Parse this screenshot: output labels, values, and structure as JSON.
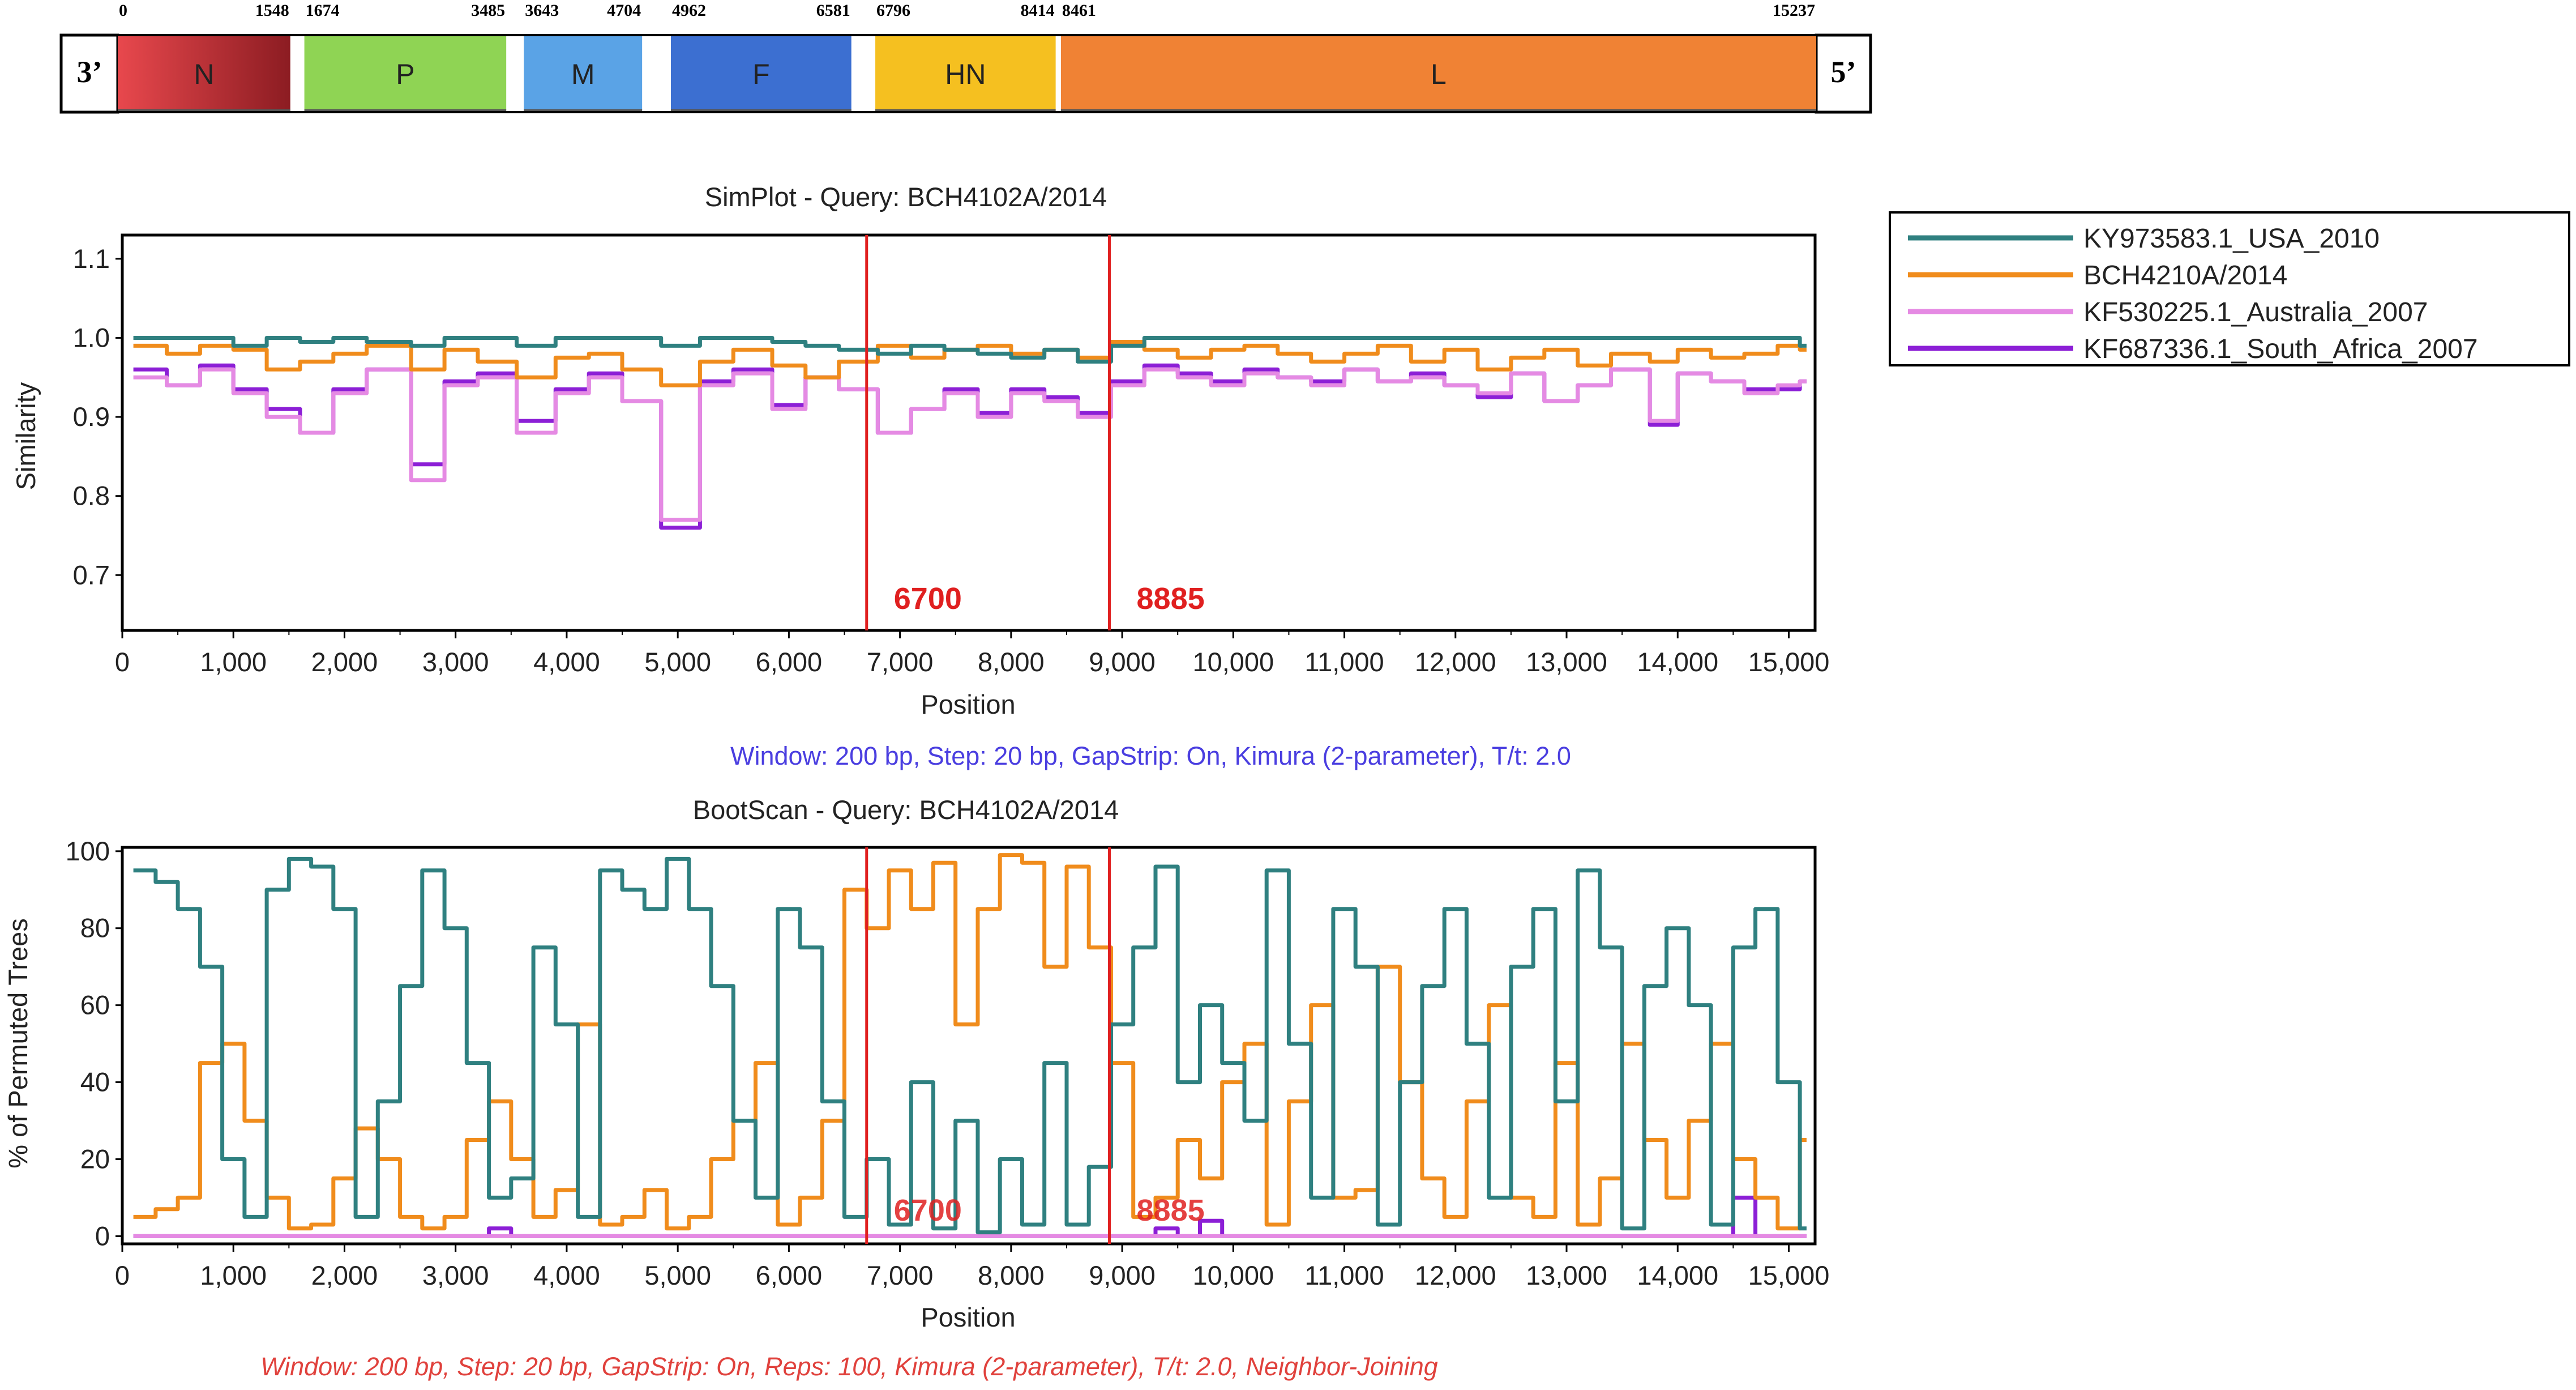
{
  "genome_map": {
    "left_end": "3’",
    "right_end": "5’",
    "genes": [
      {
        "name": "N",
        "start": "0",
        "end": "1548",
        "color": "#e8484d",
        "color2": "#8c1c22"
      },
      {
        "name": "P",
        "start": "1674",
        "end": "3485",
        "color": "#8fd454"
      },
      {
        "name": "M",
        "start": "3643",
        "end": "4704",
        "color": "#5aa3e6"
      },
      {
        "name": "F",
        "start": "4962",
        "end": "6581",
        "color": "#3c6fd1"
      },
      {
        "name": "HN",
        "start": "6796",
        "end": "8414",
        "color": "#f5c020"
      },
      {
        "name": "L",
        "start": "8461",
        "end": "15237",
        "color": "#f08234"
      }
    ]
  },
  "legend": [
    {
      "name": "KY973583.1_USA_2010",
      "color": "#2f8080"
    },
    {
      "name": "BCH4210A/2014",
      "color": "#f08c1c"
    },
    {
      "name": "KF530225.1_Australia_2007",
      "color": "#e58ae3"
    },
    {
      "name": "KF687336.1_South_Africa_2007",
      "color": "#8c1fd6"
    }
  ],
  "simplot": {
    "title": "SimPlot - Query: BCH4102A/2014",
    "ylabel": "Similarity",
    "xlabel": "Position",
    "footer": "Window: 200 bp, Step: 20 bp, GapStrip: On, Kimura (2-parameter), T/t: 2.0",
    "footer_color": "#4a3ee0",
    "breakpoints": [
      "6700",
      "8885"
    ]
  },
  "bootscan": {
    "title": "BootScan - Query: BCH4102A/2014",
    "ylabel": "% of Permuted Trees",
    "xlabel": "Position",
    "footer": "Window: 200 bp, Step: 20 bp, GapStrip: On, Reps: 100, Kimura (2-parameter), T/t: 2.0, Neighbor-Joining",
    "footer_color": "#e0413c",
    "breakpoints": [
      "6700",
      "8885"
    ]
  },
  "chart_data": [
    {
      "type": "line",
      "title": "SimPlot - Query: BCH4102A/2014",
      "xlabel": "Position",
      "ylabel": "Similarity",
      "xlim": [
        0,
        15237
      ],
      "ylim": [
        0.63,
        1.13
      ],
      "xticks": [
        "0",
        "1,000",
        "2,000",
        "3,000",
        "4,000",
        "5,000",
        "6,000",
        "7,000",
        "8,000",
        "9,000",
        "10,000",
        "11,000",
        "12,000",
        "13,000",
        "14,000",
        "15,000"
      ],
      "yticks": [
        "0.7",
        "0.8",
        "0.9",
        "1.0",
        "1.1"
      ],
      "breakpoints": [
        6700,
        8885
      ],
      "x": [
        100,
        400,
        700,
        1000,
        1300,
        1600,
        1900,
        2200,
        2600,
        2900,
        3200,
        3550,
        3900,
        4200,
        4500,
        4850,
        5200,
        5500,
        5850,
        6150,
        6450,
        6800,
        7100,
        7400,
        7700,
        8000,
        8300,
        8600,
        8900,
        9200,
        9500,
        9800,
        10100,
        10400,
        10700,
        11000,
        11300,
        11600,
        11900,
        12200,
        12500,
        12800,
        13100,
        13400,
        13750,
        14000,
        14300,
        14600,
        14900,
        15100
      ],
      "series": [
        {
          "name": "KY973583.1_USA_2010",
          "values": [
            1.0,
            1.0,
            1.0,
            0.99,
            1.0,
            0.995,
            1.0,
            0.995,
            0.99,
            1.0,
            1.0,
            0.99,
            1.0,
            1.0,
            1.0,
            0.99,
            1.0,
            1.0,
            0.995,
            0.99,
            0.985,
            0.98,
            0.99,
            0.985,
            0.98,
            0.975,
            0.985,
            0.97,
            0.99,
            1.0,
            1.0,
            1.0,
            1.0,
            1.0,
            1.0,
            1.0,
            1.0,
            1.0,
            1.0,
            1.0,
            1.0,
            1.0,
            1.0,
            1.0,
            1.0,
            1.0,
            1.0,
            1.0,
            1.0,
            0.99
          ]
        },
        {
          "name": "BCH4210A/2014",
          "values": [
            0.99,
            0.98,
            0.99,
            0.985,
            0.96,
            0.97,
            0.98,
            0.99,
            0.96,
            0.985,
            0.97,
            0.95,
            0.975,
            0.98,
            0.96,
            0.94,
            0.97,
            0.985,
            0.965,
            0.95,
            0.97,
            0.99,
            0.975,
            0.985,
            0.99,
            0.98,
            0.985,
            0.975,
            0.995,
            0.985,
            0.975,
            0.985,
            0.99,
            0.98,
            0.97,
            0.98,
            0.99,
            0.97,
            0.985,
            0.96,
            0.975,
            0.985,
            0.965,
            0.98,
            0.97,
            0.985,
            0.975,
            0.98,
            0.99,
            0.985
          ]
        },
        {
          "name": "KF530225.1_Australia_2007",
          "values": [
            0.95,
            0.94,
            0.96,
            0.93,
            0.9,
            0.88,
            0.93,
            0.96,
            0.82,
            0.94,
            0.95,
            0.88,
            0.93,
            0.95,
            0.92,
            0.77,
            0.94,
            0.955,
            0.91,
            0.95,
            0.935,
            0.88,
            0.91,
            0.93,
            0.9,
            0.93,
            0.92,
            0.9,
            0.94,
            0.96,
            0.95,
            0.94,
            0.955,
            0.95,
            0.94,
            0.96,
            0.945,
            0.95,
            0.94,
            0.93,
            0.955,
            0.92,
            0.94,
            0.96,
            0.895,
            0.955,
            0.945,
            0.93,
            0.94,
            0.945
          ]
        },
        {
          "name": "KF687336.1_South_Africa_2007",
          "values": [
            0.96,
            0.94,
            0.965,
            0.935,
            0.91,
            0.88,
            0.935,
            0.96,
            0.84,
            0.945,
            0.955,
            0.895,
            0.935,
            0.955,
            0.92,
            0.76,
            0.945,
            0.96,
            0.915,
            0.95,
            0.935,
            0.88,
            0.91,
            0.935,
            0.905,
            0.935,
            0.925,
            0.905,
            0.945,
            0.965,
            0.955,
            0.945,
            0.96,
            0.95,
            0.945,
            0.96,
            0.945,
            0.955,
            0.94,
            0.925,
            0.955,
            0.92,
            0.94,
            0.96,
            0.89,
            0.955,
            0.945,
            0.935,
            0.935,
            0.945
          ]
        }
      ]
    },
    {
      "type": "line",
      "title": "BootScan - Query: BCH4102A/2014",
      "xlabel": "Position",
      "ylabel": "% of Permuted Trees",
      "xlim": [
        0,
        15237
      ],
      "ylim": [
        -2,
        101
      ],
      "xticks": [
        "0",
        "1,000",
        "2,000",
        "3,000",
        "4,000",
        "5,000",
        "6,000",
        "7,000",
        "8,000",
        "9,000",
        "10,000",
        "11,000",
        "12,000",
        "13,000",
        "14,000",
        "15,000"
      ],
      "yticks": [
        "0",
        "20",
        "40",
        "60",
        "80",
        "100"
      ],
      "breakpoints": [
        6700,
        8885
      ],
      "x": [
        100,
        300,
        500,
        700,
        900,
        1100,
        1300,
        1500,
        1700,
        1900,
        2100,
        2300,
        2500,
        2700,
        2900,
        3100,
        3300,
        3500,
        3700,
        3900,
        4100,
        4300,
        4500,
        4700,
        4900,
        5100,
        5300,
        5500,
        5700,
        5900,
        6100,
        6300,
        6500,
        6700,
        6900,
        7100,
        7300,
        7500,
        7700,
        7900,
        8100,
        8300,
        8500,
        8700,
        8900,
        9100,
        9300,
        9500,
        9700,
        9900,
        10100,
        10300,
        10500,
        10700,
        10900,
        11100,
        11300,
        11500,
        11700,
        11900,
        12100,
        12300,
        12500,
        12700,
        12900,
        13100,
        13300,
        13500,
        13700,
        13900,
        14100,
        14300,
        14500,
        14700,
        14900,
        15100
      ],
      "series": [
        {
          "name": "KY973583.1_USA_2010",
          "values": [
            95,
            92,
            85,
            70,
            20,
            5,
            90,
            98,
            96,
            85,
            5,
            35,
            65,
            95,
            80,
            45,
            10,
            15,
            75,
            55,
            5,
            95,
            90,
            85,
            98,
            85,
            65,
            30,
            10,
            85,
            75,
            35,
            5,
            20,
            3,
            40,
            2,
            30,
            1,
            20,
            3,
            45,
            3,
            18,
            55,
            75,
            96,
            40,
            60,
            45,
            30,
            95,
            50,
            10,
            85,
            70,
            3,
            40,
            65,
            85,
            50,
            10,
            70,
            85,
            35,
            95,
            75,
            2,
            65,
            80,
            60,
            3,
            75,
            85,
            40,
            2
          ]
        },
        {
          "name": "BCH4210A/2014",
          "values": [
            5,
            7,
            10,
            45,
            50,
            30,
            10,
            2,
            3,
            15,
            28,
            20,
            5,
            2,
            5,
            25,
            35,
            20,
            5,
            12,
            55,
            3,
            5,
            12,
            2,
            5,
            20,
            30,
            45,
            3,
            10,
            30,
            90,
            80,
            95,
            85,
            97,
            55,
            85,
            99,
            97,
            70,
            96,
            75,
            45,
            5,
            10,
            25,
            15,
            40,
            50,
            3,
            35,
            60,
            10,
            12,
            70,
            40,
            15,
            5,
            35,
            60,
            10,
            5,
            45,
            3,
            15,
            50,
            25,
            10,
            30,
            50,
            20,
            10,
            2,
            25
          ]
        },
        {
          "name": "KF530225.1_Australia_2007",
          "values": [
            0,
            0,
            0,
            0,
            0,
            0,
            0,
            0,
            0,
            0,
            0,
            0,
            0,
            0,
            0,
            0,
            0,
            0,
            0,
            0,
            0,
            0,
            0,
            0,
            0,
            0,
            0,
            0,
            0,
            0,
            0,
            0,
            0,
            0,
            0,
            0,
            0,
            0,
            0,
            0,
            0,
            0,
            0,
            0,
            0,
            0,
            0,
            0,
            0,
            0,
            0,
            0,
            0,
            0,
            0,
            0,
            0,
            0,
            0,
            0,
            0,
            0,
            0,
            0,
            0,
            0,
            0,
            0,
            0,
            0,
            0,
            0,
            0,
            0,
            0,
            0
          ]
        },
        {
          "name": "KF687336.1_South_Africa_2007",
          "values": [
            0,
            0,
            0,
            0,
            0,
            0,
            0,
            0,
            0,
            0,
            0,
            0,
            0,
            0,
            0,
            0,
            2,
            0,
            0,
            0,
            0,
            0,
            0,
            0,
            0,
            0,
            0,
            0,
            0,
            0,
            0,
            0,
            0,
            0,
            0,
            0,
            0,
            0,
            0,
            0,
            0,
            0,
            0,
            0,
            0,
            0,
            2,
            0,
            4,
            0,
            0,
            0,
            0,
            0,
            0,
            0,
            0,
            0,
            0,
            0,
            0,
            0,
            0,
            0,
            0,
            0,
            0,
            0,
            0,
            0,
            0,
            0,
            10,
            0,
            0,
            0
          ]
        }
      ]
    }
  ]
}
